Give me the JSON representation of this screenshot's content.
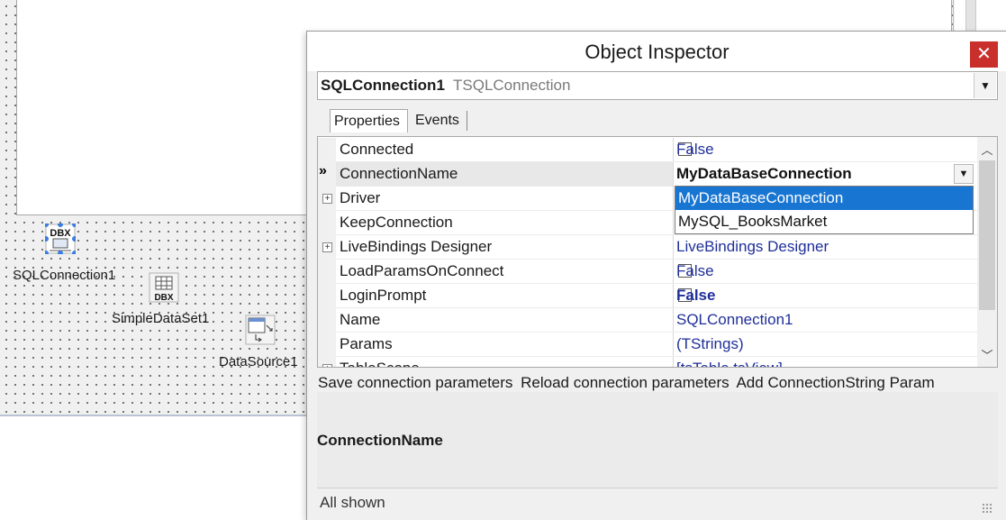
{
  "designer": {
    "components": [
      {
        "label": "SQLConnection1",
        "icon": "dbx-connection-icon"
      },
      {
        "label": "SimpleDataSet1",
        "icon": "dbx-dataset-icon"
      },
      {
        "label": "DataSource1",
        "icon": "datasource-icon"
      }
    ]
  },
  "inspector": {
    "title": "Object Inspector",
    "close_glyph": "✕",
    "selected_object": {
      "name": "SQLConnection1",
      "type": "TSQLConnection"
    },
    "tabs": [
      {
        "label": "Properties",
        "active": true
      },
      {
        "label": "Events",
        "active": false
      }
    ],
    "properties": [
      {
        "name": "Connected",
        "value": "False",
        "kind": "checkbox"
      },
      {
        "name": "ConnectionName",
        "value": "MyDataBaseConnection",
        "kind": "dropdown",
        "selected": true
      },
      {
        "name": "Driver",
        "value": "",
        "kind": "expandable"
      },
      {
        "name": "KeepConnection",
        "value": "",
        "kind": "text"
      },
      {
        "name": "LiveBindings Designer",
        "value": "LiveBindings Designer",
        "kind": "expandable-link"
      },
      {
        "name": "LoadParamsOnConnect",
        "value": "False",
        "kind": "checkbox"
      },
      {
        "name": "LoginPrompt",
        "value": "False",
        "kind": "checkbox-bold"
      },
      {
        "name": "Name",
        "value": "SQLConnection1",
        "kind": "text"
      },
      {
        "name": "Params",
        "value": "(TStrings)",
        "kind": "text"
      },
      {
        "name": "TableScope",
        "value": "[tsTable,tsView]",
        "kind": "expandable"
      }
    ],
    "dropdown_options": [
      "MyDataBaseConnection",
      "MySQL_BooksMarket"
    ],
    "verbs": [
      "Save connection parameters",
      "Reload connection parameters",
      "Add ConnectionString Param"
    ],
    "description_title": "ConnectionName",
    "status": "All shown",
    "colors": {
      "close": "#c9302c",
      "highlight": "#1876d2",
      "value_text": "#1f2f9a"
    }
  }
}
